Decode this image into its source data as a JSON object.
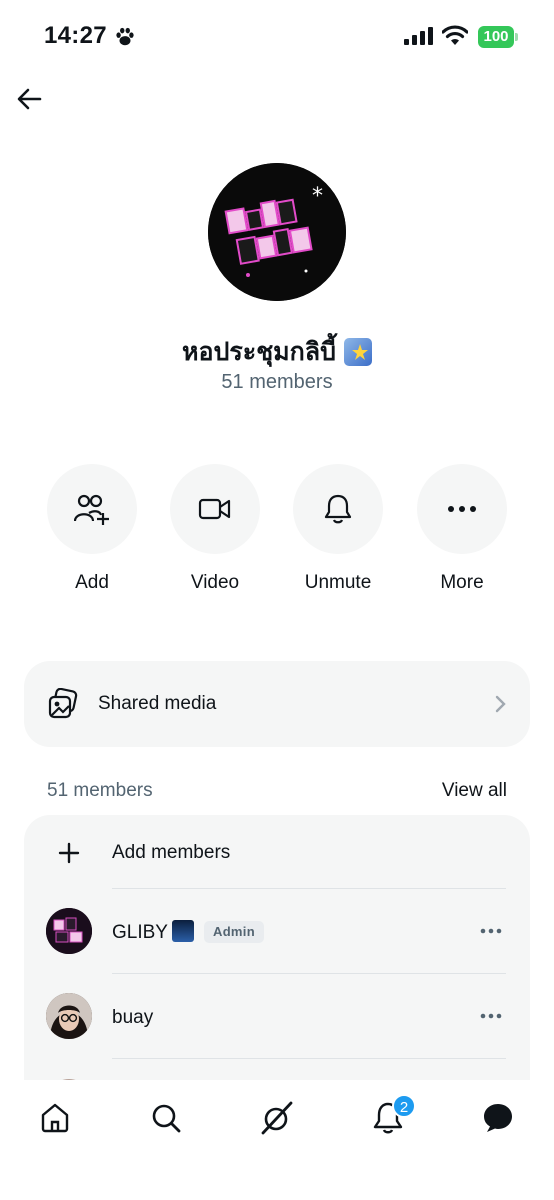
{
  "status_bar": {
    "time": "14:27",
    "battery": "100"
  },
  "group": {
    "name": "หอประชุมกลิบี้",
    "member_count": "51 members"
  },
  "actions": [
    {
      "label": "Add",
      "icon": "add-people-icon"
    },
    {
      "label": "Video",
      "icon": "video-camera-icon"
    },
    {
      "label": "Unmute",
      "icon": "bell-icon"
    },
    {
      "label": "More",
      "icon": "more-dots-icon"
    }
  ],
  "shared_media": {
    "label": "Shared media",
    "icon": "gallery-icon"
  },
  "members": {
    "header": "51 members",
    "view_all": "View all",
    "add_label": "Add members",
    "list": [
      {
        "name": "GLIBY",
        "badge": "Admin"
      },
      {
        "name": "buay",
        "badge": ""
      }
    ]
  },
  "nav": {
    "notification_count": "2",
    "items": [
      "home-icon",
      "search-icon",
      "grok-icon",
      "notifications-icon",
      "messages-icon"
    ]
  },
  "colors": {
    "accent": "#1d9bf0",
    "battery": "#34c759",
    "secondary_text": "#536471"
  }
}
